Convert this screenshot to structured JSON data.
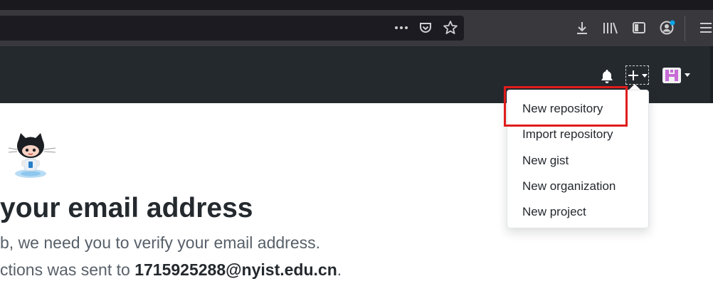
{
  "browser": {
    "toolbar_icons": [
      "more-icon",
      "pocket-icon",
      "bookmark-star-icon",
      "downloads-icon",
      "library-icon",
      "sidebar-icon",
      "account-icon",
      "menu-icon"
    ]
  },
  "header": {
    "notification_icon": "bell-icon",
    "create_icon": "plus-icon",
    "avatar_icon": "user-avatar-icon"
  },
  "dropdown": {
    "items": [
      {
        "label": "New repository"
      },
      {
        "label": "Import repository"
      },
      {
        "label": "New gist"
      },
      {
        "label": "New organization"
      },
      {
        "label": "New project"
      }
    ]
  },
  "main": {
    "heading": "your email address",
    "line1": "b, we need you to verify your email address.",
    "line2_prefix": "ctions was sent to ",
    "email": "1715925288@nyist.edu.cn",
    "line2_suffix": "."
  },
  "colors": {
    "highlight": "#e01c1c",
    "header_bg": "#24292e",
    "toolbar_bg": "#38383d",
    "notification_dot": "#0aa5e8"
  }
}
